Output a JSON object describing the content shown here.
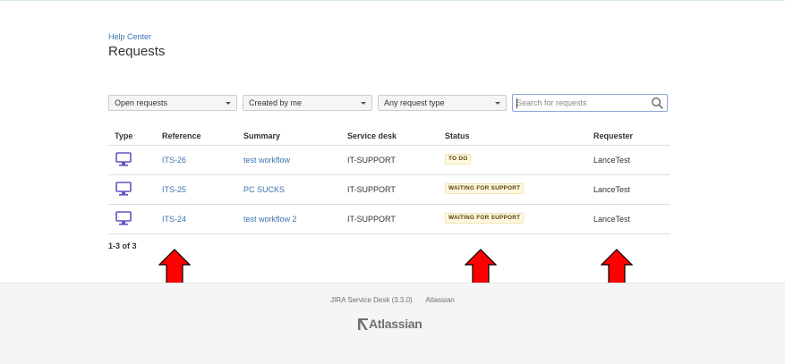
{
  "breadcrumb": "Help Center",
  "page_title": "Requests",
  "filters": {
    "status": "Open requests",
    "creator": "Created by me",
    "request_type": "Any request type",
    "search_placeholder": "Search for requests"
  },
  "table": {
    "headers": [
      "Type",
      "Reference",
      "Summary",
      "Service desk",
      "Status",
      "Requester"
    ],
    "rows": [
      {
        "icon": "computer-monitor-icon",
        "reference": "ITS-26",
        "summary": "test workflow",
        "service_desk": "IT-SUPPORT",
        "status": "TO DO",
        "requester": "LanceTest"
      },
      {
        "icon": "computer-monitor-icon",
        "reference": "ITS-25",
        "summary": "PC SUCKS",
        "service_desk": "IT-SUPPORT",
        "status": "WAITING FOR SUPPORT",
        "requester": "LanceTest"
      },
      {
        "icon": "computer-monitor-icon",
        "reference": "ITS-24",
        "summary": "test workflow 2",
        "service_desk": "IT-SUPPORT",
        "status": "WAITING FOR SUPPORT",
        "requester": "LanceTest"
      }
    ]
  },
  "result_count": "1-3 of 3",
  "footer": {
    "product": "JIRA Service Desk (3.3.0)",
    "vendor": "Atlassian",
    "logo_text": "Atlassian"
  },
  "colors": {
    "link": "#3b73af",
    "status_bg": "#fff8e1",
    "annotation_arrow": "#ff0000"
  }
}
